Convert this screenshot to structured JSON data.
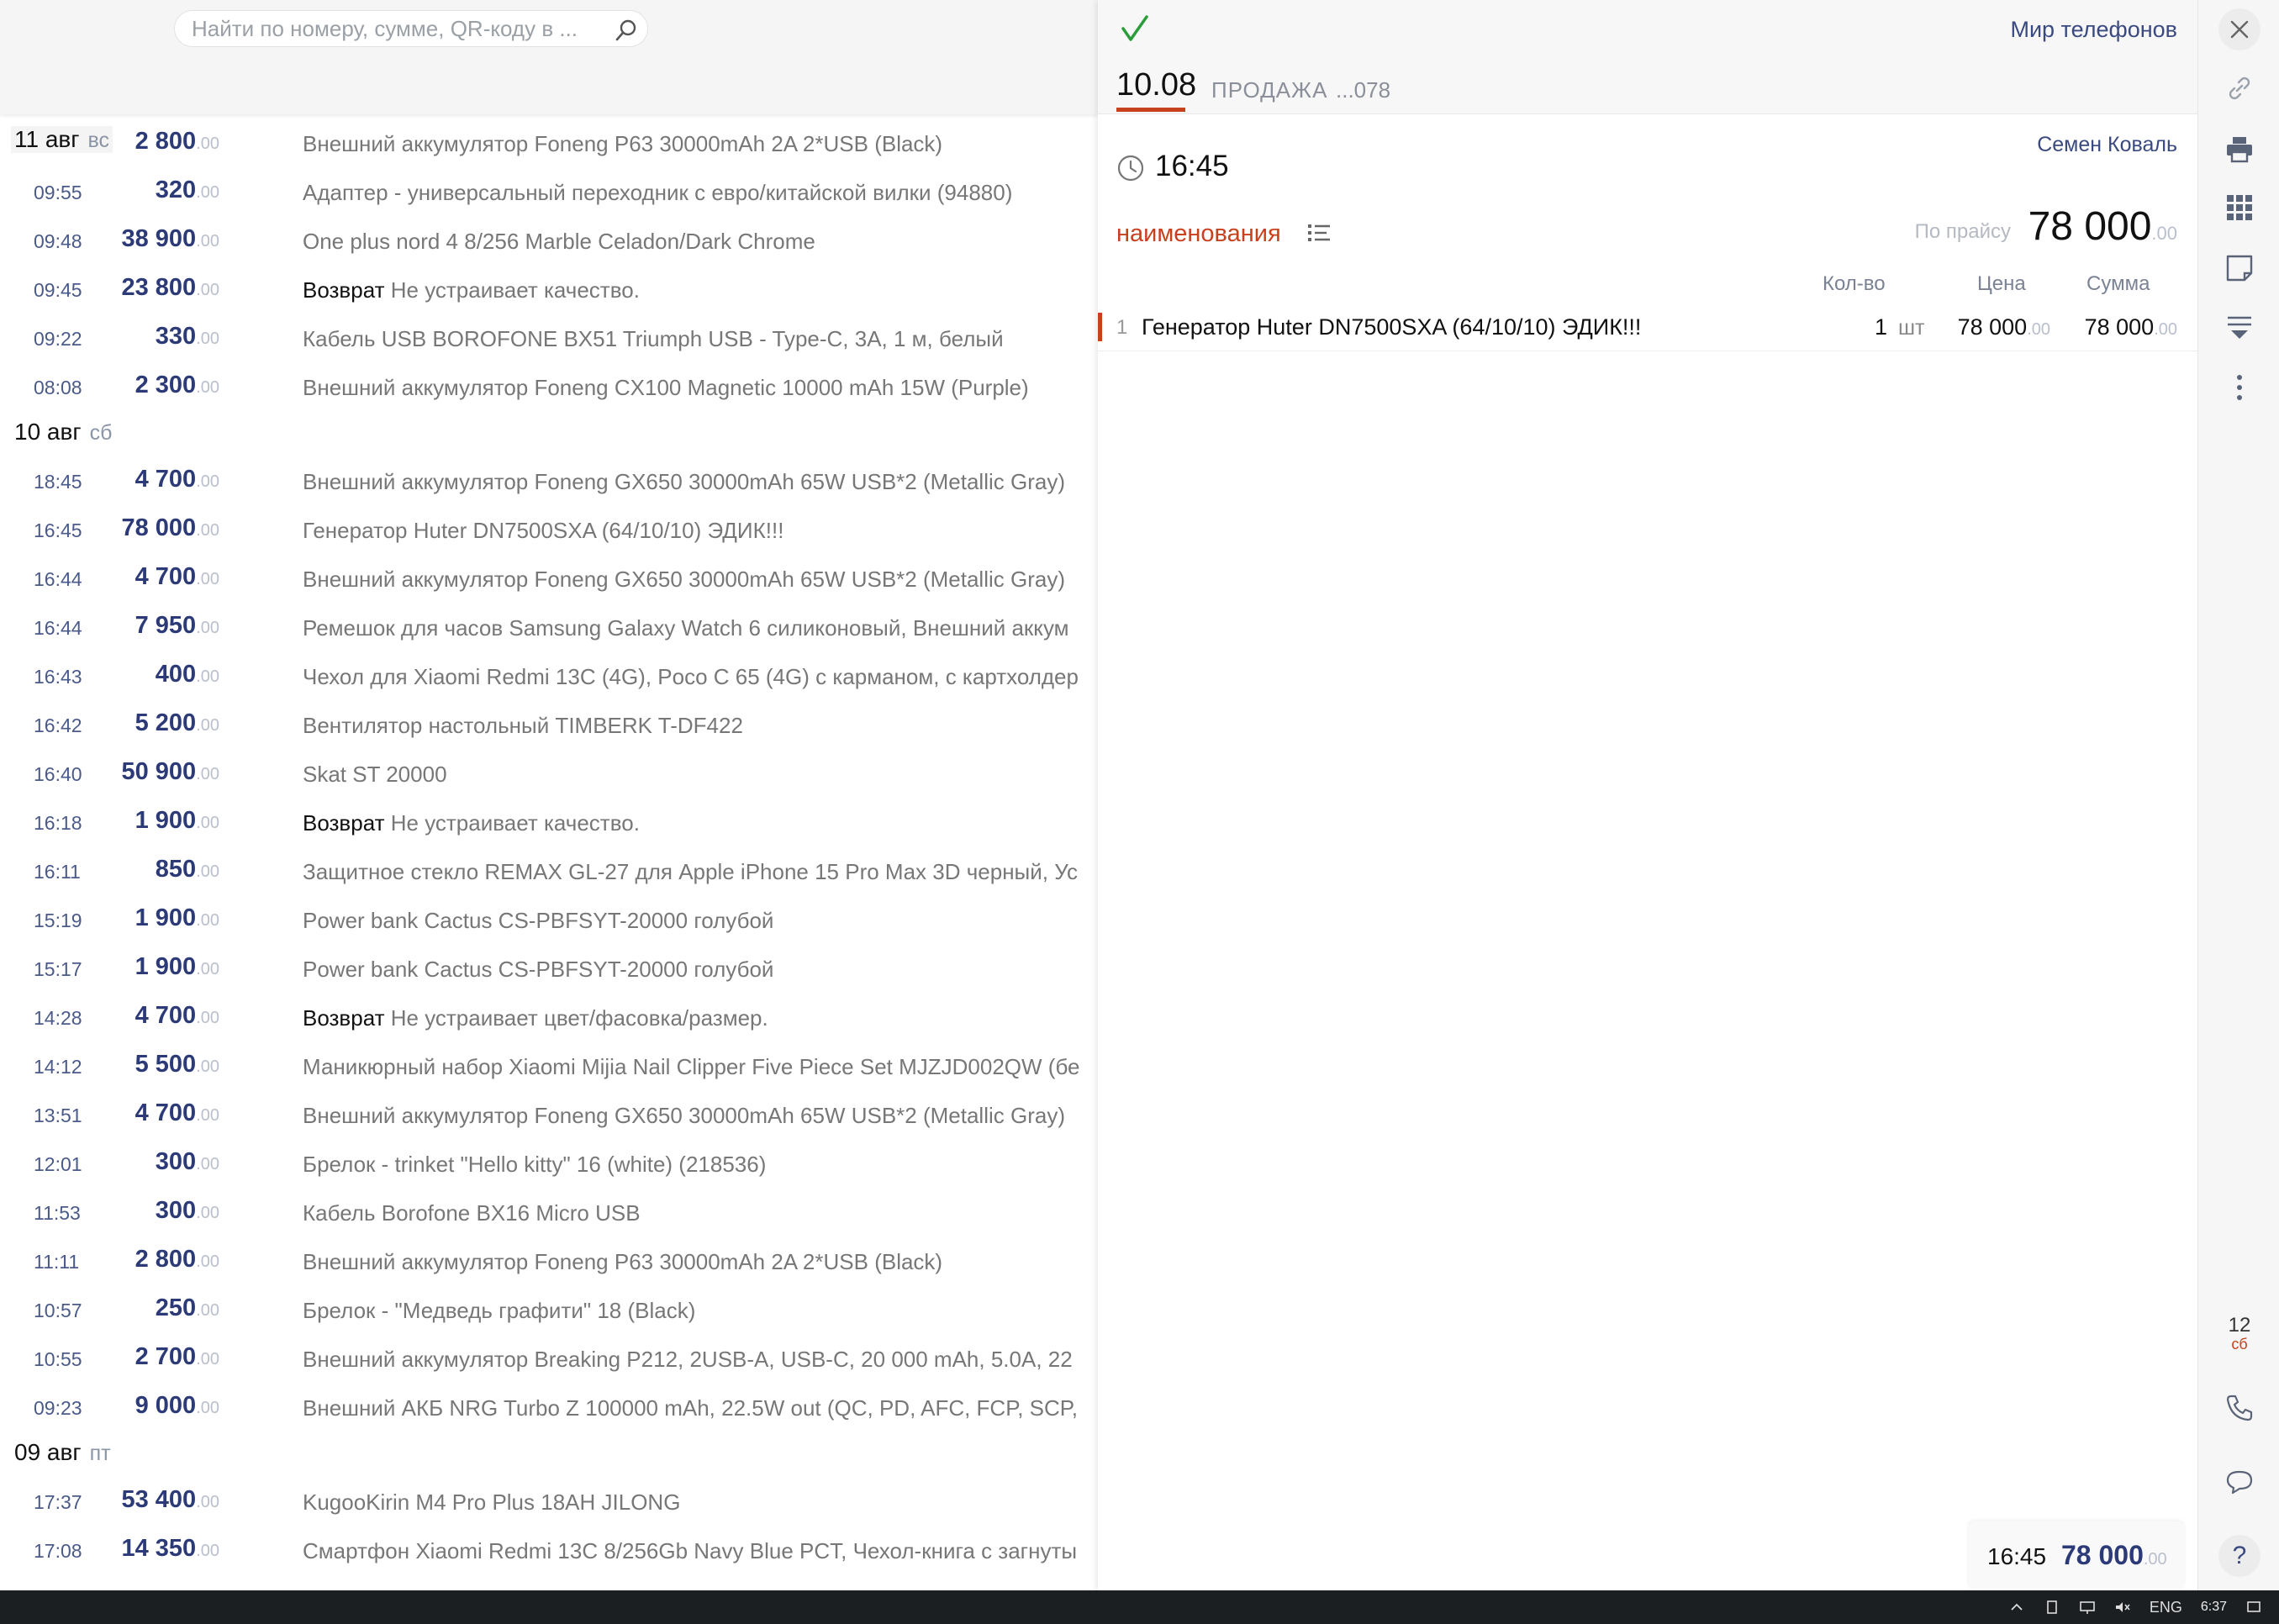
{
  "search": {
    "placeholder": "Найти по номеру, сумме, QR-коду в ..."
  },
  "list": [
    {
      "kind": "day",
      "date": "11 авг",
      "dow": "вс",
      "shaded": true
    },
    {
      "kind": "tx",
      "time": "",
      "amount": "2 800",
      "cents": ".00",
      "desc": "Внешний аккумулятор Foneng P63 30000mAh 2A 2*USB (Black)"
    },
    {
      "kind": "tx",
      "time": "09:55",
      "amount": "320",
      "cents": ".00",
      "desc": "Адаптер - универсальный переходник с евро/китайской вилки (94880)"
    },
    {
      "kind": "tx",
      "time": "09:48",
      "amount": "38 900",
      "cents": ".00",
      "desc": "One plus nord 4 8/256 Marble Celadon/Dark Chrome"
    },
    {
      "kind": "tx",
      "time": "09:45",
      "amount": "23 800",
      "cents": ".00",
      "ret": "Возврат",
      "desc": "Не устраивает качество."
    },
    {
      "kind": "tx",
      "time": "09:22",
      "amount": "330",
      "cents": ".00",
      "desc": "Кабель USB BOROFONE BX51 Triumph USB - Type-C, 3A, 1 м, белый"
    },
    {
      "kind": "tx",
      "time": "08:08",
      "amount": "2 300",
      "cents": ".00",
      "desc": "Внешний аккумулятор Foneng CX100 Magnetic 10000 mAh 15W (Purple)"
    },
    {
      "kind": "day",
      "date": "10 авг",
      "dow": "сб"
    },
    {
      "kind": "tx",
      "time": "18:45",
      "amount": "4 700",
      "cents": ".00",
      "desc": "Внешний аккумулятор Foneng GX650 30000mAh 65W USB*2 (Metallic Gray)"
    },
    {
      "kind": "tx",
      "time": "16:45",
      "amount": "78 000",
      "cents": ".00",
      "desc": "Генератор Huter DN7500SXA (64/10/10) ЭДИК!!!"
    },
    {
      "kind": "tx",
      "time": "16:44",
      "amount": "4 700",
      "cents": ".00",
      "desc": "Внешний аккумулятор Foneng GX650 30000mAh 65W USB*2 (Metallic Gray)"
    },
    {
      "kind": "tx",
      "time": "16:44",
      "amount": "7 950",
      "cents": ".00",
      "desc": "Ремешок для часов Samsung Galaxy Watch 6 силиконовый, Внешний аккум"
    },
    {
      "kind": "tx",
      "time": "16:43",
      "amount": "400",
      "cents": ".00",
      "desc": "Чехол для Xiaomi Redmi 13C (4G), Poco C 65 (4G) с карманом, с картхолдер"
    },
    {
      "kind": "tx",
      "time": "16:42",
      "amount": "5 200",
      "cents": ".00",
      "desc": "Вентилятор настольный TIMBERK T-DF422"
    },
    {
      "kind": "tx",
      "time": "16:40",
      "amount": "50 900",
      "cents": ".00",
      "desc": "Skat ST 20000"
    },
    {
      "kind": "tx",
      "time": "16:18",
      "amount": "1 900",
      "cents": ".00",
      "ret": "Возврат",
      "desc": "Не устраивает качество."
    },
    {
      "kind": "tx",
      "time": "16:11",
      "amount": "850",
      "cents": ".00",
      "desc": "Защитное стекло REMAX GL-27 для Apple iPhone 15 Pro Max 3D черный, Ус"
    },
    {
      "kind": "tx",
      "time": "15:19",
      "amount": "1 900",
      "cents": ".00",
      "desc": "Power bank Cactus CS-PBFSYT-20000 голубой"
    },
    {
      "kind": "tx",
      "time": "15:17",
      "amount": "1 900",
      "cents": ".00",
      "desc": "Power bank Cactus CS-PBFSYT-20000 голубой"
    },
    {
      "kind": "tx",
      "time": "14:28",
      "amount": "4 700",
      "cents": ".00",
      "ret": "Возврат",
      "desc": "Не устраивает цвет/фасовка/размер."
    },
    {
      "kind": "tx",
      "time": "14:12",
      "amount": "5 500",
      "cents": ".00",
      "desc": "Маникюрный набор Xiaomi Mijia Nail Clipper Five Piece Set MJZJD002QW (бе"
    },
    {
      "kind": "tx",
      "time": "13:51",
      "amount": "4 700",
      "cents": ".00",
      "desc": "Внешний аккумулятор Foneng GX650 30000mAh 65W USB*2 (Metallic Gray)"
    },
    {
      "kind": "tx",
      "time": "12:01",
      "amount": "300",
      "cents": ".00",
      "desc": "Брелок - trinket \"Hello kitty\" 16 (white) (218536)"
    },
    {
      "kind": "tx",
      "time": "11:53",
      "amount": "300",
      "cents": ".00",
      "desc": "Кабель Borofone BX16 Micro USB"
    },
    {
      "kind": "tx",
      "time": "11:11",
      "amount": "2 800",
      "cents": ".00",
      "desc": "Внешний аккумулятор Foneng P63 30000mAh 2A 2*USB (Black)"
    },
    {
      "kind": "tx",
      "time": "10:57",
      "amount": "250",
      "cents": ".00",
      "desc": "Брелок - \"Медведь графити\" 18 (Black)"
    },
    {
      "kind": "tx",
      "time": "10:55",
      "amount": "2 700",
      "cents": ".00",
      "desc": "Внешний аккумулятор Breaking P212, 2USB-A, USB-C, 20 000 mAh, 5.0A, 22"
    },
    {
      "kind": "tx",
      "time": "09:23",
      "amount": "9 000",
      "cents": ".00",
      "desc": "Внешний АКБ NRG Turbo Z 100000 mAh, 22.5W out (QC, PD, AFC, FCP, SCP,"
    },
    {
      "kind": "day",
      "date": "09 авг",
      "dow": "пт"
    },
    {
      "kind": "tx",
      "time": "17:37",
      "amount": "53 400",
      "cents": ".00",
      "desc": "KugooKirin M4 Pro Plus 18AH JILONG"
    },
    {
      "kind": "tx",
      "time": "17:08",
      "amount": "14 350",
      "cents": ".00",
      "desc": "Смартфон Xiaomi Redmi 13C 8/256Gb Navy Blue PCT, Чехол-книга с загнуты"
    }
  ],
  "panel": {
    "org": "Мир телефонов",
    "date": "10.08",
    "type": "ПРОДАЖА",
    "number": "...078",
    "employee": "Семен Коваль",
    "time": "16:45",
    "tab": "наименования",
    "pricelist_label": "По прайсу",
    "total": "78 000",
    "total_cents": ".00",
    "columns": {
      "qty": "Кол-во",
      "price": "Цена",
      "sum": "Сумма"
    },
    "item": {
      "index": "1",
      "name": "Генератор Huter DN7500SXA (64/10/10) ЭДИК!!!",
      "qty": "1",
      "unit": "шт",
      "price": "78 000",
      "price_cents": ".00",
      "sum": "78 000",
      "sum_cents": ".00"
    },
    "footer": {
      "time": "16:45",
      "amount": "78 000",
      "cents": ".00"
    }
  },
  "toolbar": {
    "icons": [
      "close-icon",
      "link-icon",
      "printer-icon",
      "grid-icon",
      "note-icon",
      "filter-icon",
      "more-icon",
      "phone-icon",
      "chat-icon",
      "help-icon"
    ],
    "calendar_day": "12",
    "calendar_dow": "сб",
    "help": "?"
  },
  "taskbar": {
    "lang": "ENG",
    "time": "6:37"
  },
  "colors": {
    "accent": "#c8411f",
    "amount": "#2c3a78",
    "check": "#2a9d3a"
  }
}
